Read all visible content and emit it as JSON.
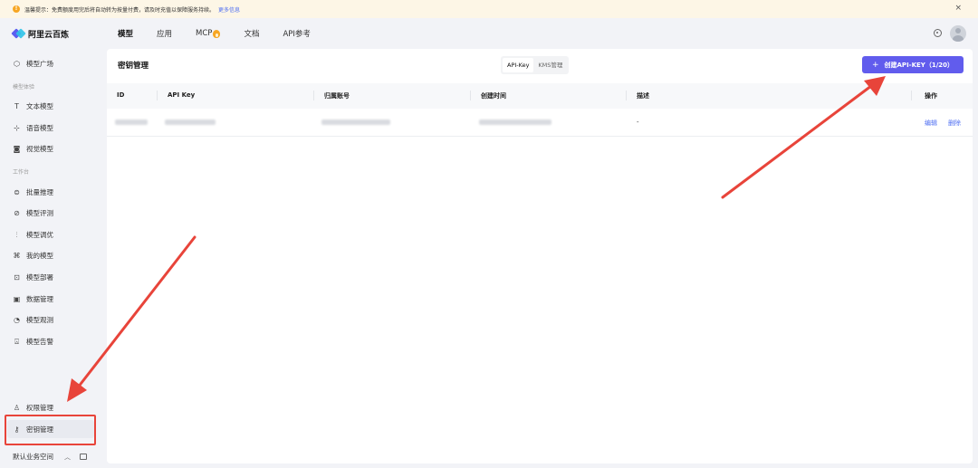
{
  "notice": {
    "text": "温馨提示：免费额度用完后将自动转为按量付费，请及时充值以保障服务持续。",
    "more_link": "更多信息",
    "close": "×"
  },
  "topnav": {
    "brand": "阿里云百炼",
    "items": [
      {
        "label": "模型",
        "active": true
      },
      {
        "label": "应用"
      },
      {
        "label": "MCP"
      },
      {
        "label": "文档"
      },
      {
        "label": "API参考"
      }
    ]
  },
  "sidebar": {
    "model_plaza": {
      "label": "模型广场",
      "icon": "cube-icon"
    },
    "section_experience": "模型体验",
    "experience_items": [
      {
        "label": "文本模型",
        "icon": "text-icon"
      },
      {
        "label": "语音模型",
        "icon": "waveform-icon"
      },
      {
        "label": "视觉模型",
        "icon": "camera-icon"
      }
    ],
    "section_workbench": "工作台",
    "workbench_items": [
      {
        "label": "批量推理",
        "icon": "batch-icon"
      },
      {
        "label": "模型评测",
        "icon": "compass-icon"
      },
      {
        "label": "模型调优",
        "icon": "sliders-icon"
      },
      {
        "label": "我的模型",
        "icon": "nodes-icon"
      },
      {
        "label": "模型部署",
        "icon": "deploy-icon"
      },
      {
        "label": "数据管理",
        "icon": "chart-icon"
      },
      {
        "label": "模型观测",
        "icon": "pie-icon"
      },
      {
        "label": "模型告警",
        "icon": "alert-icon"
      }
    ],
    "permission": {
      "label": "权限管理",
      "icon": "user-icon"
    },
    "keys": {
      "label": "密钥管理",
      "icon": "key-icon",
      "active": true
    },
    "workspace": "默认业务空间"
  },
  "main": {
    "title": "密钥管理",
    "tabs": [
      {
        "label": "API-Key",
        "active": true
      },
      {
        "label": "KMS管理"
      }
    ],
    "create_button": "创建API-KEY（1/20）",
    "columns": [
      "ID",
      "API Key",
      "归属账号",
      "创建时间",
      "描述",
      "操作"
    ],
    "rows": [
      {
        "description": "-",
        "edit": "编辑",
        "delete": "删除"
      }
    ]
  },
  "colors": {
    "accent": "#615ced",
    "link": "#4e6ef2",
    "annotation": "#e8443a",
    "notice_bg": "#fdf6e6"
  }
}
